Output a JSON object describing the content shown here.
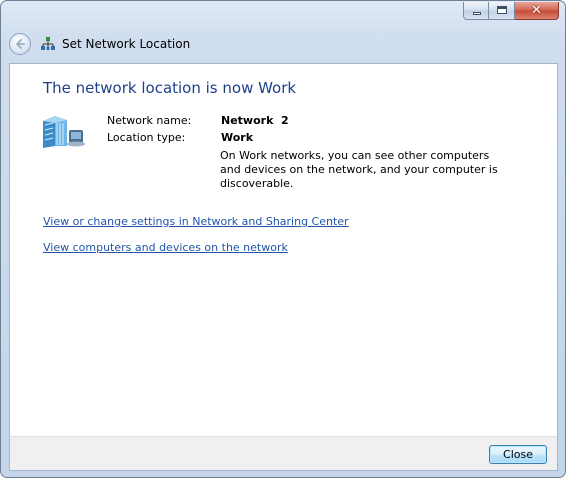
{
  "window": {
    "title": "Set Network Location",
    "caption_buttons": {
      "minimize": "minimize",
      "maximize": "maximize",
      "close": "✕"
    }
  },
  "main": {
    "heading": "The network location is now Work",
    "network_name_label": "Network name:",
    "network_name_value": "Network  2",
    "location_type_label": "Location type:",
    "location_type_value": "Work",
    "description": "On Work networks, you can see other computers and devices on the network, and your computer is discoverable.",
    "links": [
      "View or change settings in Network and Sharing Center",
      "View computers and devices on the network"
    ]
  },
  "footer": {
    "close_label": "Close"
  },
  "colors": {
    "heading": "#1e3f8a",
    "link": "#2255aa",
    "footer_bg": "#f0f0f0"
  }
}
